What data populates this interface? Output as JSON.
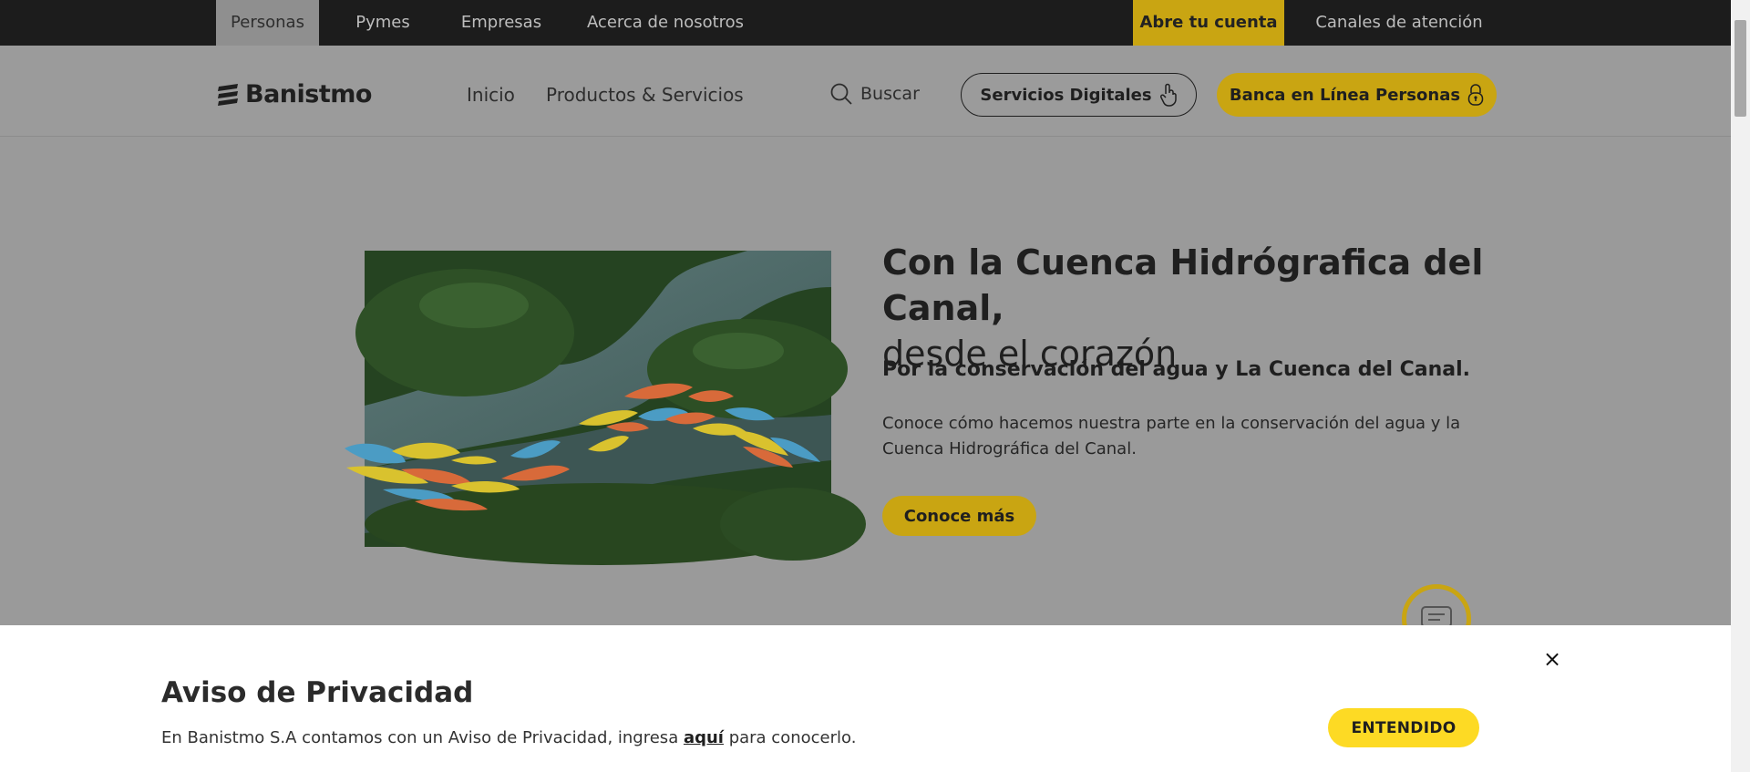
{
  "topbar": {
    "tabs": [
      "Personas",
      "Pymes",
      "Empresas",
      "Acerca de nosotros"
    ],
    "cta": "Abre tu cuenta",
    "support": "Canales de atención"
  },
  "header": {
    "logo": "Banistmo",
    "nav": [
      "Inicio",
      "Productos & Servicios"
    ],
    "search_label": "Buscar",
    "digital_services": "Servicios Digitales",
    "online_banking": "Banca en Línea Personas"
  },
  "hero": {
    "title_bold": "Con la Cuenca Hidrógrafica del Canal,",
    "title_light": "desde el corazón",
    "subtitle": "Por la conservación del agua y La Cuenca del Canal.",
    "description": "Conoce cómo hacemos nuestra parte en la conservación del agua y la Cuenca Hidrográfica del Canal.",
    "button": "Conoce más"
  },
  "privacy": {
    "title": "Aviso de Privacidad",
    "text_before": "En Banistmo S.A contamos con un Aviso de Privacidad, ingresa ",
    "link": "aquí",
    "text_after": " para conocerlo.",
    "button": "ENTENDIDO",
    "close": "×"
  },
  "colors": {
    "accent": "#c9a512",
    "accent_bright": "#fdda24",
    "dark": "#1c1c1c"
  },
  "icons": [
    "search-icon",
    "hand-pointer-icon",
    "lock-icon",
    "chat-icon",
    "close-icon"
  ]
}
